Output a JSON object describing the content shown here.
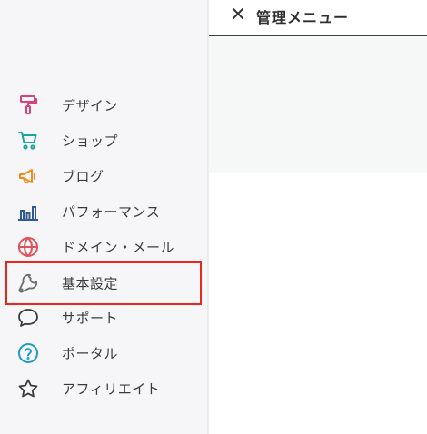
{
  "sidebar": {
    "items": [
      {
        "label": "デザイン",
        "icon": "paint-roller-icon",
        "color": "#d9417a"
      },
      {
        "label": "ショップ",
        "icon": "shopping-cart-icon",
        "color": "#1aa79a"
      },
      {
        "label": "ブログ",
        "icon": "megaphone-icon",
        "color": "#f08a1c"
      },
      {
        "label": "パフォーマンス",
        "icon": "bar-chart-icon",
        "color": "#2e5b94"
      },
      {
        "label": "ドメイン・メール",
        "icon": "globe-icon",
        "color": "#e0525b"
      },
      {
        "label": "基本設定",
        "icon": "wrench-icon",
        "color": "#6b6b6b"
      },
      {
        "label": "サポート",
        "icon": "chat-bubble-icon",
        "color": "#3a3a3a"
      },
      {
        "label": "ポータル",
        "icon": "help-circle-icon",
        "color": "#1d9cc8"
      },
      {
        "label": "アフィリエイト",
        "icon": "star-icon",
        "color": "#3a3a3a"
      }
    ],
    "highlighted_item": "基本設定",
    "highlight_color": "#e8281e"
  },
  "header": {
    "close_icon": "close-icon",
    "title": "管理メニュー"
  }
}
